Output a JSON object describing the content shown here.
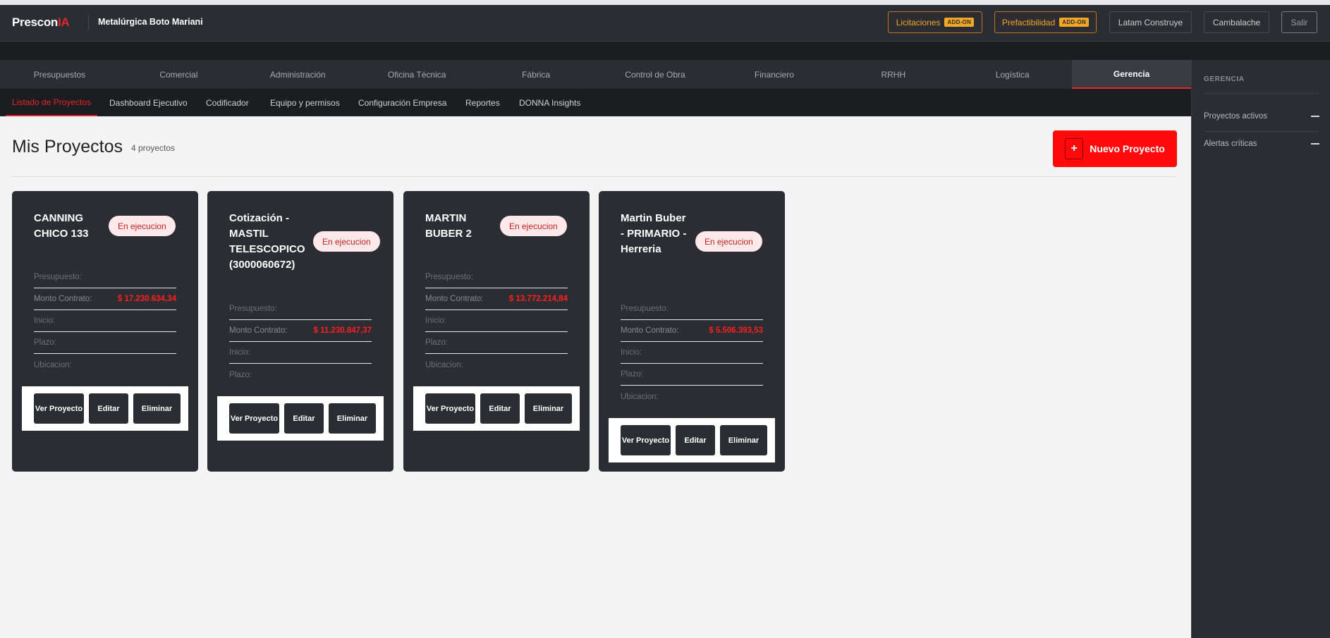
{
  "header": {
    "logo_main": "Prescon",
    "logo_accent": "IA",
    "company": "Metalúrgica Boto Mariani",
    "buttons": {
      "licitaciones": "Licitaciones",
      "prefactibilidad": "Prefactibilidad",
      "addon": "ADD-ON",
      "latam": "Latam Construye",
      "cambalache": "Cambalache",
      "salir": "Salir"
    }
  },
  "main_nav": [
    "Presupuestos",
    "Comercial",
    "Administración",
    "Oficina Técnica",
    "Fábrica",
    "Control de Obra",
    "Financiero",
    "RRHH",
    "Logística",
    "Gerencia"
  ],
  "main_nav_active": "Gerencia",
  "sub_nav": [
    "Listado de Proyectos",
    "Dashboard Ejecutivo",
    "Codificador",
    "Equipo y permisos",
    "Configuración Empresa",
    "Reportes",
    "DONNA Insights"
  ],
  "sub_nav_active": "Listado de Proyectos",
  "sidebar": {
    "title": "GERENCIA",
    "items": [
      "Proyectos activos",
      "Alertas críticas"
    ]
  },
  "page": {
    "title": "Mis Proyectos",
    "count": "4 proyectos",
    "new_button": "Nuevo Proyecto",
    "plus": "+"
  },
  "labels": {
    "presupuesto": "Presupuesto:",
    "monto": "Monto Contrato:",
    "inicio": "Inicio:",
    "plazo": "Plazo:",
    "ubicacion": "Ubicacion:",
    "ver": "Ver Proyecto",
    "editar": "Editar",
    "eliminar": "Eliminar"
  },
  "projects": [
    {
      "title": "CANNING CHICO 133",
      "status": "En ejecucion",
      "monto": "$ 17.230.634,34"
    },
    {
      "title": "Cotización - MASTIL TELESCOPICO (3000060672)",
      "status": "En ejecucion",
      "monto": "$ 11.230.847,37"
    },
    {
      "title": "MARTIN BUBER 2",
      "status": "En ejecucion",
      "monto": "$ 13.772.214,84"
    },
    {
      "title": "Martin Buber - PRIMARIO - Herreria",
      "status": "En ejecucion",
      "monto": "$ 5.506.393,53"
    }
  ],
  "colors": {
    "accent": "#ff0a0a",
    "dark": "#2b2d33",
    "addon": "#f5a623",
    "badge_bg": "#fde9e9"
  }
}
